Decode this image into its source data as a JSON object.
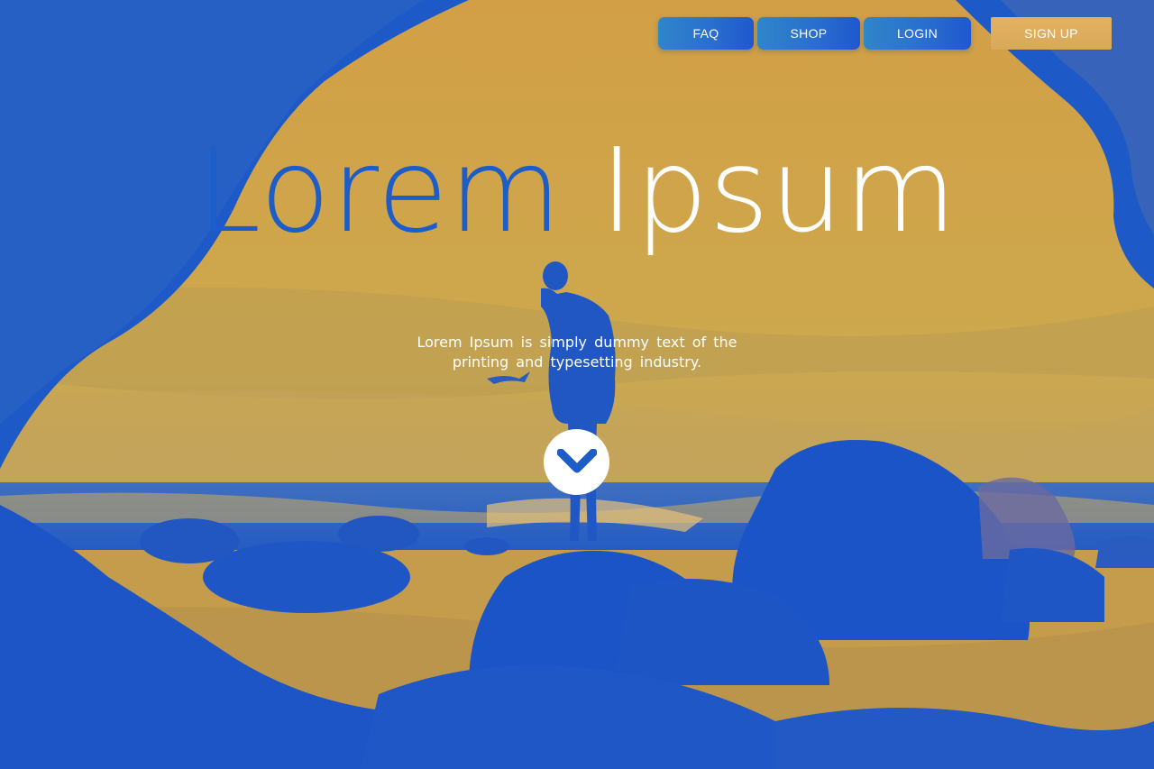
{
  "nav": {
    "faq": "FAQ",
    "shop": "SHOP",
    "login": "LOGIN",
    "signup": "SIGN UP"
  },
  "hero": {
    "title_part1": "Lorem",
    "title_part2": "Ipsum",
    "subtitle": "Lorem Ipsum is simply dummy text of the printing and typesetting industry."
  },
  "scroll_button": {
    "icon": "chevron-down-icon"
  },
  "colors": {
    "brand_blue": "#1d5dc7",
    "sky_gold": "#c9a24c",
    "signup_gold": "#dfae5e",
    "text_white": "#ffffff"
  }
}
